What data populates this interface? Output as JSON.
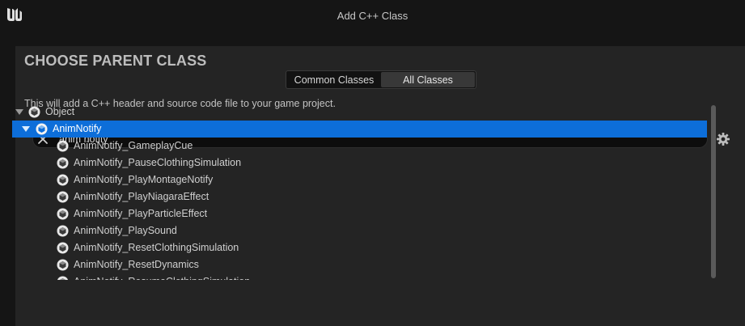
{
  "window": {
    "title": "Add C++ Class"
  },
  "panel": {
    "heading": "CHOOSE PARENT CLASS",
    "tabs": [
      {
        "label": "Common Classes",
        "active": false
      },
      {
        "label": "All Classes",
        "active": true
      }
    ],
    "description": "This will add a C++ header and source code file to your game project."
  },
  "search": {
    "value": "anim notify",
    "placeholder": ""
  },
  "tree": {
    "root": {
      "label": "Object",
      "expanded": true
    },
    "selected": {
      "label": "AnimNotify",
      "expanded": true
    },
    "children": [
      {
        "label": "AnimNotify_GameplayCue"
      },
      {
        "label": "AnimNotify_PauseClothingSimulation"
      },
      {
        "label": "AnimNotify_PlayMontageNotify"
      },
      {
        "label": "AnimNotify_PlayNiagaraEffect"
      },
      {
        "label": "AnimNotify_PlayParticleEffect"
      },
      {
        "label": "AnimNotify_PlaySound"
      },
      {
        "label": "AnimNotify_ResetClothingSimulation"
      },
      {
        "label": "AnimNotify_ResetDynamics"
      },
      {
        "label": "AnimNotify_ResumeClothingSimulation"
      }
    ]
  },
  "icons": {
    "logo": "unreal-logo-icon",
    "clear": "clear-icon",
    "settings": "gear-icon",
    "class": "class-icon",
    "expand": "expand-arrow-icon"
  },
  "colors": {
    "selection": "#0d6ed9",
    "panel": "#242424",
    "background": "#151515"
  }
}
